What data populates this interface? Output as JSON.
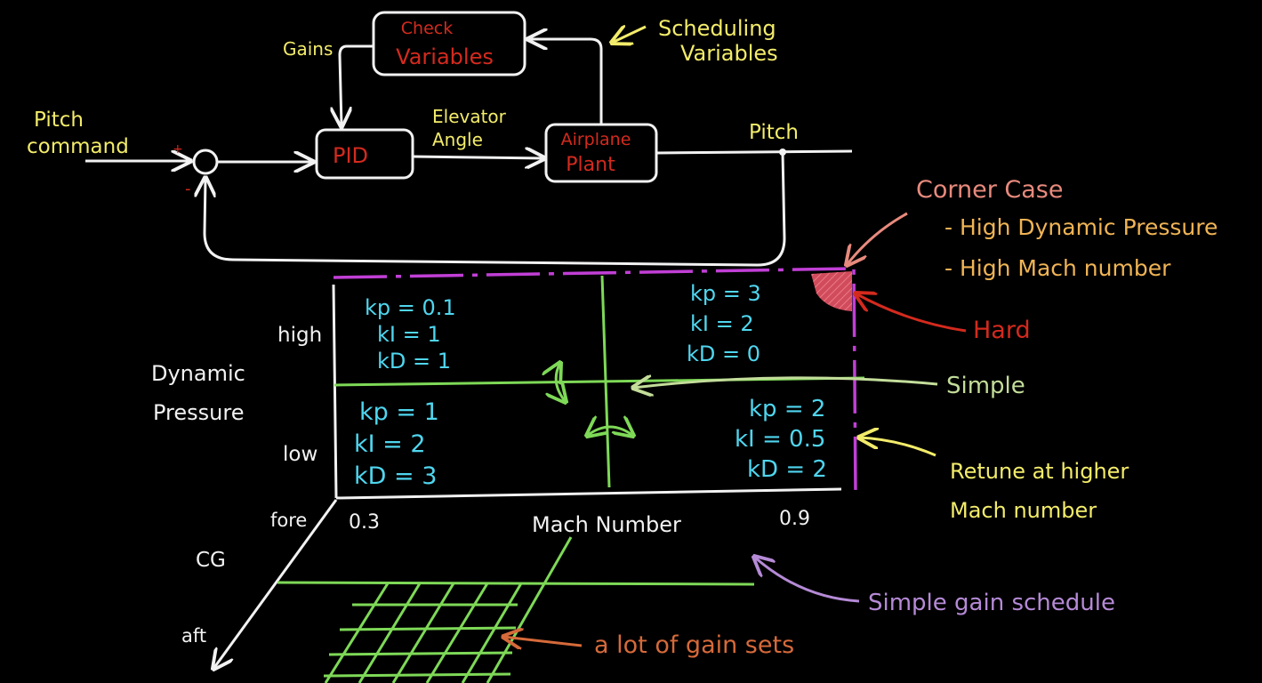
{
  "colors": {
    "white": "#f2f2f2",
    "yellow": "#f3ec6a",
    "red": "#d42a1e",
    "cyan": "#4fd6ef",
    "green": "#7ed957",
    "pink": "#e88a7d",
    "orange": "#f0b455",
    "purple": "#c13fd6",
    "lavender": "#b58ad6",
    "brown": "#d66a3a",
    "sage": "#c3dd9a"
  },
  "control": {
    "check_variables": [
      "Check",
      "Variables"
    ],
    "gains": "Gains",
    "scheduling": [
      "Scheduling",
      "Variables"
    ],
    "pitch_command": [
      "Pitch",
      "command"
    ],
    "plus": "+",
    "minus": "-",
    "pid": "PID",
    "elevator": [
      "Elevator",
      "Angle"
    ],
    "plant": [
      "Airplane",
      "Plant"
    ],
    "pitch": "Pitch"
  },
  "schedule": {
    "y_label": [
      "Dynamic",
      "Pressure"
    ],
    "high": "high",
    "low": "low",
    "fore": "fore",
    "aft": "aft",
    "cg": "CG",
    "x_label": "Mach Number",
    "x_min": "0.3",
    "x_max": "0.9",
    "cells": {
      "high_low_mach": [
        "kp = 0.1",
        "kI = 1",
        "kD = 1"
      ],
      "high_high_mach": [
        "kp = 3",
        "kI = 2",
        "kD = 0"
      ],
      "low_low_mach": [
        "kp = 1",
        "kI = 2",
        "kD = 3"
      ],
      "low_high_mach": [
        "kp = 2",
        "kI = 0.5",
        "kD = 2"
      ]
    }
  },
  "notes": {
    "corner_case": "Corner Case",
    "corner_1": "- High Dynamic Pressure",
    "corner_2": "- High Mach number",
    "hard": "Hard",
    "simple": "Simple",
    "retune": [
      "Retune at higher",
      "Mach number"
    ],
    "simple_schedule": "Simple gain schedule",
    "lot_of_sets": "a lot of gain sets"
  }
}
